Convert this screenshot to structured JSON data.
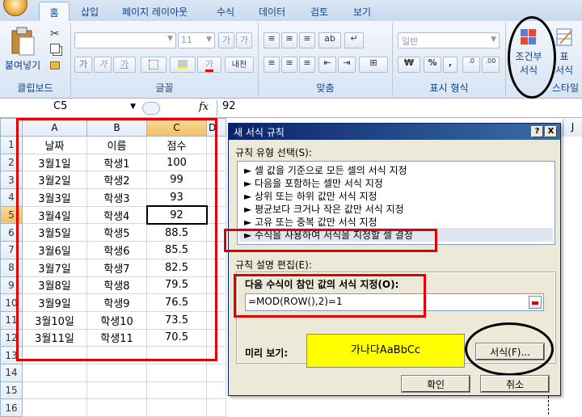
{
  "ribbon": {
    "tabs": [
      "홈",
      "삽입",
      "페이지 레이아웃",
      "수식",
      "데이터",
      "검토",
      "보기"
    ],
    "paste_label": "붙여넣기",
    "font_name": "",
    "font_size": "11",
    "grow_font": "가",
    "shrink_font": "가",
    "bold": "가",
    "italic": "가",
    "underline": "가",
    "phonetic": "내천",
    "number_format": "일반",
    "currency": "₩",
    "percent": "%",
    "comma": ",",
    "cond_format_line1": "조건부",
    "cond_format_line2": "서식",
    "table_format_line1": "표",
    "table_format_line2": "서식",
    "groups": {
      "clipboard": "클립보드",
      "font": "글꼴",
      "alignment": "맞춤",
      "number": "표시 형식",
      "styles": "스타일"
    }
  },
  "formula_bar": {
    "name_box": "C5",
    "fx": "fx",
    "value": "92"
  },
  "sheet": {
    "columns": [
      "A",
      "B",
      "C"
    ],
    "extra_col_d": "D",
    "extra_col_j": "J",
    "rows": [
      {
        "n": "1",
        "a": "날짜",
        "b": "이름",
        "c": "점수"
      },
      {
        "n": "2",
        "a": "3월1일",
        "b": "학생1",
        "c": "100"
      },
      {
        "n": "3",
        "a": "3월2일",
        "b": "학생2",
        "c": "99"
      },
      {
        "n": "4",
        "a": "3월3일",
        "b": "학생3",
        "c": "93"
      },
      {
        "n": "5",
        "a": "3월4일",
        "b": "학생4",
        "c": "92"
      },
      {
        "n": "6",
        "a": "3월5일",
        "b": "학생5",
        "c": "88.5"
      },
      {
        "n": "7",
        "a": "3월6일",
        "b": "학생6",
        "c": "85.5"
      },
      {
        "n": "8",
        "a": "3월7일",
        "b": "학생7",
        "c": "82.5"
      },
      {
        "n": "9",
        "a": "3월8일",
        "b": "학생8",
        "c": "79.5"
      },
      {
        "n": "10",
        "a": "3월9일",
        "b": "학생9",
        "c": "76.5"
      },
      {
        "n": "11",
        "a": "3월10일",
        "b": "학생10",
        "c": "73.5"
      },
      {
        "n": "12",
        "a": "3월11일",
        "b": "학생11",
        "c": "70.5"
      },
      {
        "n": "13",
        "a": "",
        "b": "",
        "c": ""
      },
      {
        "n": "14",
        "a": "",
        "b": "",
        "c": ""
      },
      {
        "n": "15",
        "a": "",
        "b": "",
        "c": ""
      },
      {
        "n": "16",
        "a": "",
        "b": "",
        "c": ""
      }
    ]
  },
  "dialog": {
    "title": "새 서식 규칙",
    "help": "?",
    "close": "X",
    "rule_type_label": "규칙 유형 선택(S):",
    "rule_types": [
      "► 셀 값을 기준으로 모든 셀의 서식 지정",
      "► 다음을 포함하는 셀만 서식 지정",
      "► 상위 또는 하위 값만 서식 지정",
      "► 평균보다 크거나 작은 값만 서식 지정",
      "► 고유 또는 중복 값만 서식 지정",
      "► 수식을 사용하여 서식을 지정할 셀 결정"
    ],
    "edit_label": "규칙 설명 편집(E):",
    "formula_label": "다음 수식이 참인 값의 서식 지정(O):",
    "formula_value": "=MOD(ROW(),2)=1",
    "preview_label": "미리 보기:",
    "preview_text": "가나다AaBbCc",
    "preview_bg": "#ffff00",
    "format_button": "서식(F)...",
    "ok_button": "확인",
    "cancel_button": "취소"
  }
}
